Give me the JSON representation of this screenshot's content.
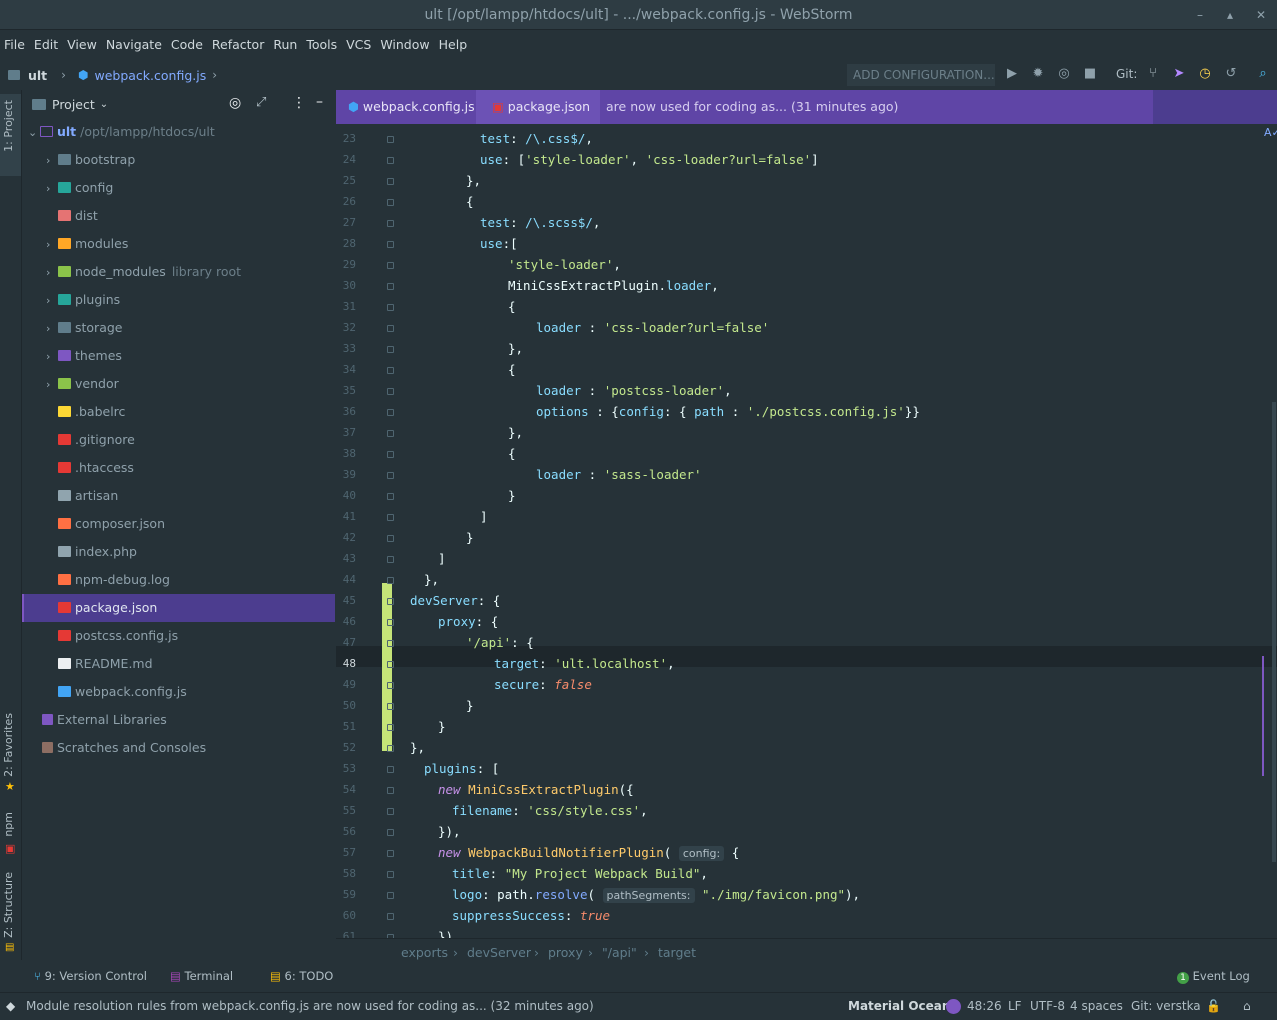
{
  "window": {
    "title": "ult [/opt/lampp/htdocs/ult] - .../webpack.config.js - WebStorm"
  },
  "menu": [
    "File",
    "Edit",
    "View",
    "Navigate",
    "Code",
    "Refactor",
    "Run",
    "Tools",
    "VCS",
    "Window",
    "Help"
  ],
  "navbar": {
    "project": "ult",
    "file": "webpack.config.js",
    "add_config": "ADD CONFIGURATION...",
    "git_label": "Git:"
  },
  "side_tabs": {
    "project": "1: Project",
    "favorites": "2: Favorites",
    "npm": "npm",
    "structure": "Z: Structure"
  },
  "project_panel": {
    "header": "Project",
    "root_name": "ult",
    "root_path": "/opt/lampp/htdocs/ult",
    "items": [
      {
        "label": "bootstrap",
        "suffix": "",
        "icon": "folder-icon",
        "color": "#607d8b",
        "expandable": true
      },
      {
        "label": "config",
        "suffix": "",
        "icon": "folder-config-icon",
        "color": "#26a69a",
        "expandable": true
      },
      {
        "label": "dist",
        "suffix": "",
        "icon": "folder-dist-icon",
        "color": "#e57373",
        "expandable": false
      },
      {
        "label": "modules",
        "suffix": "",
        "icon": "folder-modules-icon",
        "color": "#ffa726",
        "expandable": true
      },
      {
        "label": "node_modules",
        "suffix": "library root",
        "icon": "folder-node-icon",
        "color": "#8bc34a",
        "expandable": true
      },
      {
        "label": "plugins",
        "suffix": "",
        "icon": "folder-plugins-icon",
        "color": "#26a69a",
        "expandable": true
      },
      {
        "label": "storage",
        "suffix": "",
        "icon": "folder-icon",
        "color": "#607d8b",
        "expandable": true
      },
      {
        "label": "themes",
        "suffix": "",
        "icon": "folder-themes-icon",
        "color": "#7e57c2",
        "expandable": true
      },
      {
        "label": "vendor",
        "suffix": "",
        "icon": "folder-vendor-icon",
        "color": "#8bc34a",
        "expandable": true
      },
      {
        "label": ".babelrc",
        "suffix": "",
        "icon": "babel-icon",
        "color": "#fdd835",
        "expandable": false
      },
      {
        "label": ".gitignore",
        "suffix": "",
        "icon": "git-icon",
        "color": "#e53935",
        "expandable": false
      },
      {
        "label": ".htaccess",
        "suffix": "",
        "icon": "feather-icon",
        "color": "#e53935",
        "expandable": false
      },
      {
        "label": "artisan",
        "suffix": "",
        "icon": "file-icon",
        "color": "#90a4ae",
        "expandable": false
      },
      {
        "label": "composer.json",
        "suffix": "",
        "icon": "composer-icon",
        "color": "#ff7043",
        "expandable": false
      },
      {
        "label": "index.php",
        "suffix": "",
        "icon": "file-icon",
        "color": "#90a4ae",
        "expandable": false
      },
      {
        "label": "npm-debug.log",
        "suffix": "",
        "icon": "log-icon",
        "color": "#ff7043",
        "expandable": false
      },
      {
        "label": "package.json",
        "suffix": "",
        "icon": "npm-icon",
        "color": "#e53935",
        "expandable": false,
        "selected": true
      },
      {
        "label": "postcss.config.js",
        "suffix": "",
        "icon": "postcss-icon",
        "color": "#e53935",
        "expandable": false
      },
      {
        "label": "README.md",
        "suffix": "",
        "icon": "readme-icon",
        "color": "#eceff1",
        "expandable": false
      },
      {
        "label": "webpack.config.js",
        "suffix": "",
        "icon": "webpack-icon",
        "color": "#42a5f5",
        "expandable": false
      }
    ],
    "external_libraries": "External Libraries",
    "scratches": "Scratches and Consoles"
  },
  "editor": {
    "tabs": [
      "webpack.config.js",
      "package.json"
    ],
    "notice": "are now used for coding as... (31 minutes ago)",
    "lines": [
      {
        "n": "23",
        "h": "<span class=\"p\">test</span>: <span class=\"r\">/\\.css$/</span>,"
      },
      {
        "n": "24",
        "h": "<span class=\"p\">use</span>: [<span class=\"s\">'style-loader'</span>, <span class=\"s\">'css-loader?url=false'</span>]"
      },
      {
        "n": "25",
        "h": "},"
      },
      {
        "n": "26",
        "h": "{"
      },
      {
        "n": "27",
        "h": "<span class=\"p\">test</span>: <span class=\"r\">/\\.scss$/</span>,"
      },
      {
        "n": "28",
        "h": "<span class=\"p\">use</span>:["
      },
      {
        "n": "29",
        "h": "<span class=\"s\">'style-loader'</span>,"
      },
      {
        "n": "30",
        "h": "MiniCssExtractPlugin.<span class=\"p\">loader</span>,"
      },
      {
        "n": "31",
        "h": "{"
      },
      {
        "n": "32",
        "h": "<span class=\"p\">loader</span> : <span class=\"s\">'css-loader?url=false'</span>"
      },
      {
        "n": "33",
        "h": "},"
      },
      {
        "n": "34",
        "h": "{"
      },
      {
        "n": "35",
        "h": "<span class=\"p\">loader</span> : <span class=\"s\">'postcss-loader'</span>,"
      },
      {
        "n": "36",
        "h": "<span class=\"p\">options</span> : {<span class=\"p\">config</span>: { <span class=\"p\">path</span> : <span class=\"s\">'./postcss.config.js'</span>}}"
      },
      {
        "n": "37",
        "h": "},"
      },
      {
        "n": "38",
        "h": "{"
      },
      {
        "n": "39",
        "h": "<span class=\"p\">loader</span> : <span class=\"s\">'sass-loader'</span>"
      },
      {
        "n": "40",
        "h": "}"
      },
      {
        "n": "41",
        "h": "]"
      },
      {
        "n": "42",
        "h": "}"
      },
      {
        "n": "43",
        "h": "]"
      },
      {
        "n": "44",
        "h": "},"
      },
      {
        "n": "45",
        "h": "<span class=\"p\">devServer</span>: {"
      },
      {
        "n": "46",
        "h": "<span class=\"p\">proxy</span>: {"
      },
      {
        "n": "47",
        "h": "<span class=\"s\">'/api'</span>: {"
      },
      {
        "n": "48",
        "h": "<span class=\"p\">target</span>: <span class=\"s\">'ult.localhost'</span>,"
      },
      {
        "n": "49",
        "h": "<span class=\"p\">secure</span>: <span class=\"b\">false</span>"
      },
      {
        "n": "50",
        "h": "}"
      },
      {
        "n": "51",
        "h": "}"
      },
      {
        "n": "52",
        "h": "},"
      },
      {
        "n": "53",
        "h": "<span class=\"p\">plugins</span>: ["
      },
      {
        "n": "54",
        "h": "<span class=\"k\">new</span> <span class=\"h\">MiniCssExtractPlugin</span>({"
      },
      {
        "n": "55",
        "h": "<span class=\"p\">filename</span>: <span class=\"s\">'css/style.css'</span>,"
      },
      {
        "n": "56",
        "h": "}),"
      },
      {
        "n": "57",
        "h": "<span class=\"k\">new</span> <span class=\"h\">WebpackBuildNotifierPlugin</span>( <span class=\"hint\">config:</span> {"
      },
      {
        "n": "58",
        "h": "<span class=\"p\">title</span>: <span class=\"s\">\"My Project Webpack Build\"</span>,"
      },
      {
        "n": "59",
        "h": "<span class=\"p\">logo</span>: path.<span class=\"f\">resolve</span>( <span class=\"hint\">pathSegments:</span> <span class=\"s\">\"./img/favicon.png\"</span>),"
      },
      {
        "n": "60",
        "h": "<span class=\"p\">suppressSuccess</span>: <span class=\"b\">true</span>"
      },
      {
        "n": "61",
        "h": "}),"
      }
    ]
  },
  "breadcrumbs": [
    "exports",
    "devServer",
    "proxy",
    "\"/api\"",
    "target"
  ],
  "tool_windows": {
    "version_control": "9: Version Control",
    "terminal": "Terminal",
    "todo": "6: TODO",
    "event_log": "Event Log",
    "event_count": "1"
  },
  "status": {
    "message": "Module resolution rules from webpack.config.js are now used for coding as... (32 minutes ago)",
    "theme": "Material Oceani",
    "position": "48:26",
    "line_sep": "LF",
    "encoding": "UTF-8",
    "indent": "4 spaces",
    "git": "Git: verstka"
  },
  "colors": {
    "accent": "#7e57c2",
    "background": "#263238",
    "selection": "#4c3d8f"
  }
}
